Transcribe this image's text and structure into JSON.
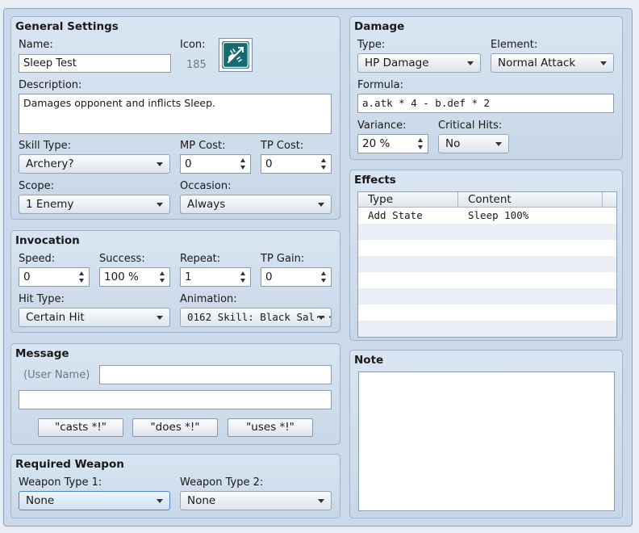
{
  "general": {
    "title": "General Settings",
    "name_label": "Name:",
    "name_value": "Sleep Test",
    "icon_label": "Icon:",
    "icon_index": "185",
    "icon_semantic": "skill-icon",
    "description_label": "Description:",
    "description_value": "Damages opponent and inflicts Sleep.",
    "skill_type_label": "Skill Type:",
    "skill_type_value": "Archery?",
    "mp_cost_label": "MP Cost:",
    "mp_cost_value": "0",
    "tp_cost_label": "TP Cost:",
    "tp_cost_value": "0",
    "scope_label": "Scope:",
    "scope_value": "1 Enemy",
    "occasion_label": "Occasion:",
    "occasion_value": "Always"
  },
  "invocation": {
    "title": "Invocation",
    "speed_label": "Speed:",
    "speed_value": "0",
    "success_label": "Success:",
    "success_value": "100 %",
    "repeat_label": "Repeat:",
    "repeat_value": "1",
    "tp_gain_label": "TP Gain:",
    "tp_gain_value": "0",
    "hit_type_label": "Hit Type:",
    "hit_type_value": "Certain Hit",
    "animation_label": "Animation:",
    "animation_value": "0162 Skill: Black Sal···"
  },
  "message": {
    "title": "Message",
    "user_name_label": "(User Name)",
    "line1_value": "",
    "line2_value": "",
    "buttons": [
      "\"casts *!\"",
      "\"does *!\"",
      "\"uses *!\""
    ]
  },
  "required_weapon": {
    "title": "Required Weapon",
    "type1_label": "Weapon Type 1:",
    "type1_value": "None",
    "type2_label": "Weapon Type 2:",
    "type2_value": "None"
  },
  "damage": {
    "title": "Damage",
    "type_label": "Type:",
    "type_value": "HP Damage",
    "element_label": "Element:",
    "element_value": "Normal Attack",
    "formula_label": "Formula:",
    "formula_value": "a.atk * 4 - b.def * 2",
    "variance_label": "Variance:",
    "variance_value": "20 %",
    "critical_label": "Critical Hits:",
    "critical_value": "No"
  },
  "effects": {
    "title": "Effects",
    "columns": [
      "Type",
      "Content"
    ],
    "rows": [
      {
        "type": "Add State",
        "content": "Sleep 100%"
      }
    ]
  },
  "note": {
    "title": "Note",
    "value": ""
  },
  "colors": {
    "panel_bg": "#d3e0ee",
    "icon_tile": "#166a73",
    "selected_border": "#4f86c8"
  }
}
